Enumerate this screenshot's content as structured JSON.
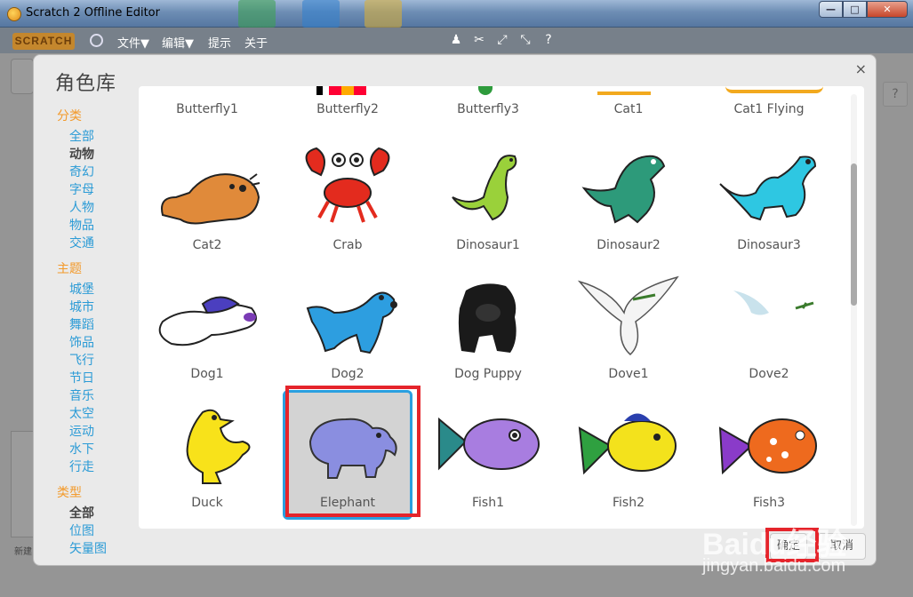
{
  "window": {
    "title": "Scratch 2 Offline Editor",
    "controls": {
      "minimize": "—",
      "maximize": "□",
      "close": "✕"
    }
  },
  "menubar": {
    "logo": "SCRATCH",
    "items": [
      "文件▼",
      "编辑▼",
      "提示",
      "关于"
    ],
    "tools": [
      "stamp-icon",
      "cut-icon",
      "grow-icon",
      "shrink-icon",
      "help-icon"
    ]
  },
  "editor": {
    "help": "?",
    "new_label": "新建"
  },
  "dialog": {
    "title": "角色库",
    "close": "×",
    "sidebar": {
      "category_header": "分类",
      "categories": [
        "全部",
        "动物",
        "奇幻",
        "字母",
        "人物",
        "物品",
        "交通"
      ],
      "category_selected": "动物",
      "theme_header": "主题",
      "themes": [
        "城堡",
        "城市",
        "舞蹈",
        "饰品",
        "飞行",
        "节日",
        "音乐",
        "太空",
        "运动",
        "水下",
        "行走"
      ],
      "type_header": "类型",
      "types": [
        "全部",
        "位图",
        "矢量图"
      ],
      "type_selected": "全部"
    },
    "sprites": [
      [
        "Butterfly1",
        "Butterfly2",
        "Butterfly3",
        "Cat1",
        "Cat1 Flying"
      ],
      [
        "Cat2",
        "Crab",
        "Dinosaur1",
        "Dinosaur2",
        "Dinosaur3"
      ],
      [
        "Dog1",
        "Dog2",
        "Dog Puppy",
        "Dove1",
        "Dove2"
      ],
      [
        "Duck",
        "Elephant",
        "Fish1",
        "Fish2",
        "Fish3"
      ]
    ],
    "selected_sprite": "Elephant",
    "ok_label": "确定",
    "cancel_label": "取消"
  },
  "watermark": {
    "brand": "Baidu经验",
    "url": "jingyan.baidu.com"
  }
}
